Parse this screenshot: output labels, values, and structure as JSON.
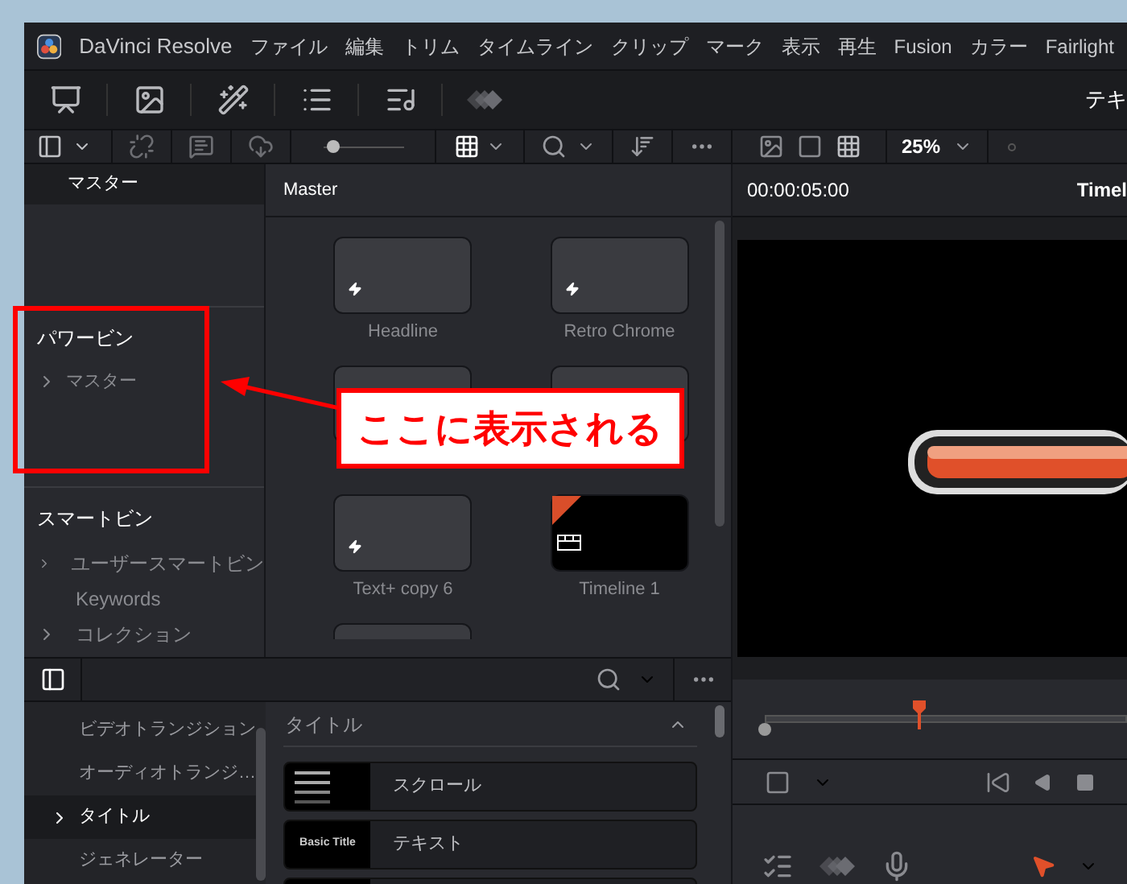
{
  "window": {
    "title": "DaVinci Resolve"
  },
  "menu": [
    "ファイル",
    "編集",
    "トリム",
    "タイムライン",
    "クリップ",
    "マーク",
    "表示",
    "再生",
    "Fusion",
    "カラー",
    "Fairlight"
  ],
  "toolbar": {
    "right_label": "テキ",
    "thumb_size": {
      "level": 0.05
    }
  },
  "viewer_toolbar": {
    "zoom": "25%"
  },
  "bins": {
    "master": "マスター",
    "power_bins": {
      "title": "パワービン",
      "items": [
        {
          "label": "マスター",
          "kind": "folder"
        }
      ]
    },
    "smart_bins": {
      "title": "スマートビン",
      "items": [
        {
          "label": "ユーザースマートビン",
          "kind": "folder"
        },
        {
          "label": "Keywords",
          "kind": "plain"
        },
        {
          "label": "コレクション",
          "kind": "folder"
        }
      ]
    }
  },
  "media": {
    "title": "Master",
    "clips": [
      {
        "label": "Headline",
        "kind": "title"
      },
      {
        "label": "Retro Chrome",
        "kind": "title"
      },
      {
        "kind": "covered"
      },
      {
        "kind": "covered"
      },
      {
        "label": "Text+ copy 6",
        "kind": "title"
      },
      {
        "label": "Timeline 1",
        "kind": "timeline"
      },
      {
        "kind": "partial"
      }
    ]
  },
  "viewer": {
    "timecode": "00:00:05:00",
    "title": "Timel"
  },
  "effects": {
    "categories": [
      {
        "label": "ビデオトランジション",
        "selected": false
      },
      {
        "label": "オーディオトランジ…",
        "selected": false
      },
      {
        "label": "タイトル",
        "selected": true
      },
      {
        "label": "ジェネレーター",
        "selected": false
      }
    ],
    "section": {
      "title": "タイトル",
      "expanded": true
    },
    "items": [
      {
        "label": "スクロール",
        "kind": "picture"
      },
      {
        "label": "テキスト",
        "kind": "text",
        "thumb_text": "Basic Title"
      },
      {
        "kind": "blank"
      }
    ]
  },
  "annotation": {
    "callout": "ここに表示される"
  }
}
